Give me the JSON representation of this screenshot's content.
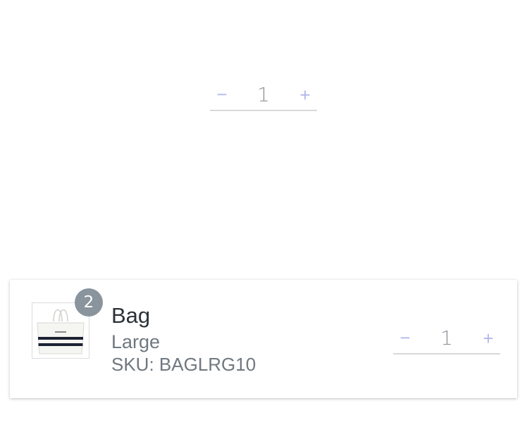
{
  "top_stepper": {
    "minus_label": "−",
    "quantity": "1",
    "plus_label": "+"
  },
  "cart_item": {
    "badge_count": "2",
    "name": "Bag",
    "variant": "Large",
    "sku": "SKU: BAGLRG10",
    "thumbnail": "tote-bag-image",
    "quantity_stepper": {
      "minus_label": "−",
      "quantity": "1",
      "plus_label": "+"
    }
  },
  "colors": {
    "stepper_button": "#b3b8ec",
    "stepper_value": "#8e949a",
    "badge_bg": "#8a949d",
    "name_text": "#2b3137",
    "detail_text": "#6f7880"
  }
}
